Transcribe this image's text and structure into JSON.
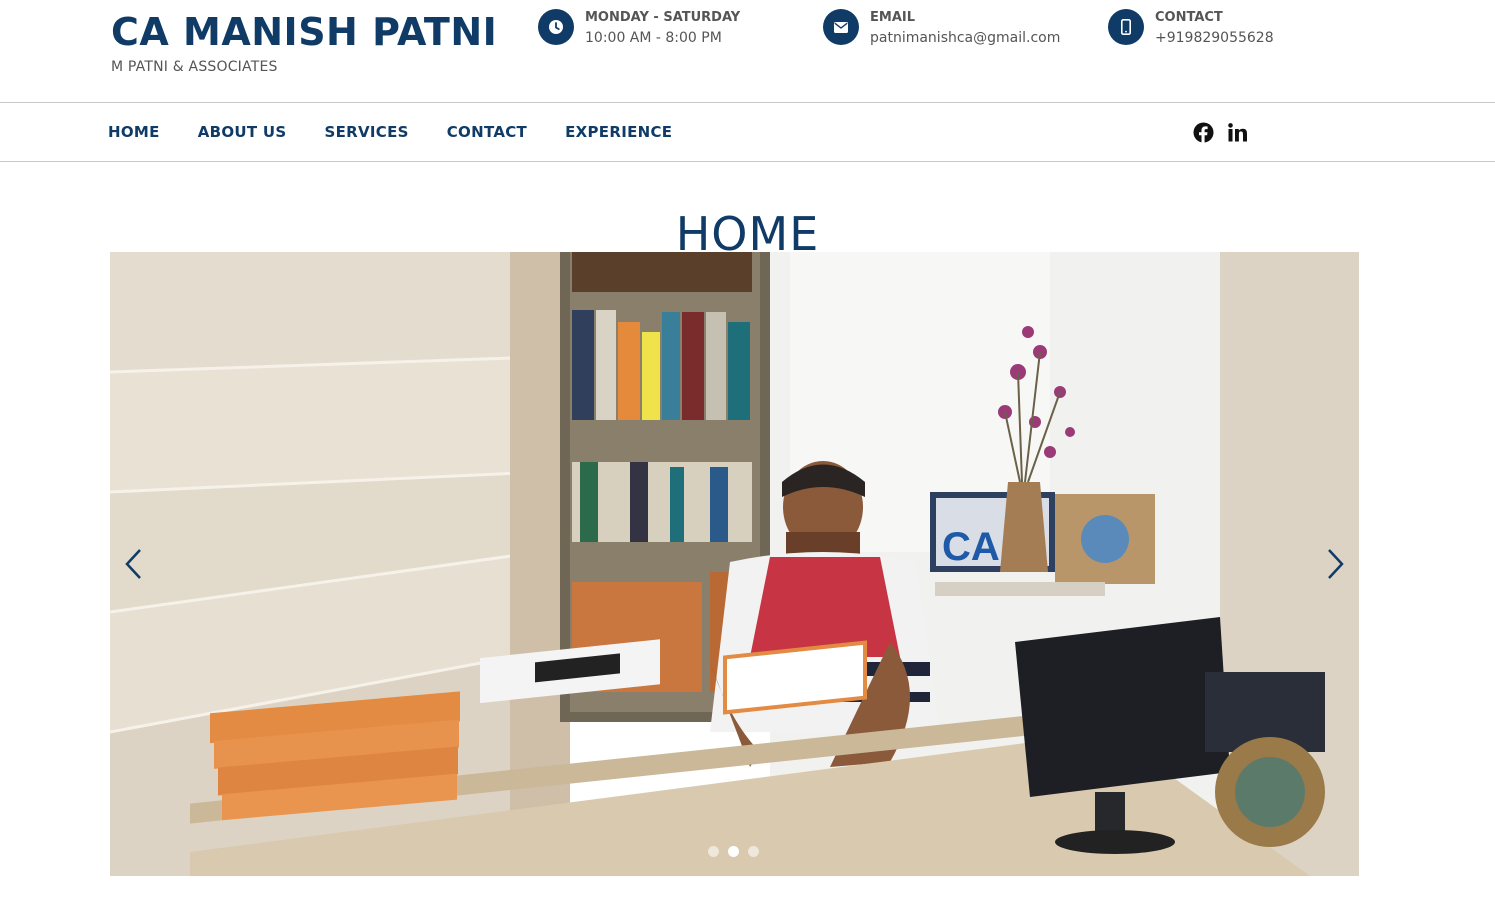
{
  "brand": {
    "title": "CA MANISH PATNI",
    "subtitle": "M PATNI & ASSOCIATES"
  },
  "info": [
    {
      "icon": "clock-icon",
      "label": "MONDAY - SATURDAY",
      "value": "10:00 AM - 8:00 PM"
    },
    {
      "icon": "envelope-icon",
      "label": "EMAIL",
      "value": "patnimanishca@gmail.com"
    },
    {
      "icon": "mobile-phone-icon",
      "label": "CONTACT",
      "value": "+919829055628"
    }
  ],
  "nav": {
    "items": [
      "HOME",
      "ABOUT US",
      "SERVICES",
      "CONTACT",
      "EXPERIENCE"
    ]
  },
  "social": [
    "facebook-icon",
    "linkedin-icon"
  ],
  "page": {
    "title": "HOME"
  },
  "carousel": {
    "slides": 3,
    "active_slide": 2,
    "image_desc": "office-photo",
    "logo_text": "CA"
  },
  "colors": {
    "primary": "#0f3b66",
    "text_muted": "#555555",
    "divider": "#c8c8c8"
  }
}
